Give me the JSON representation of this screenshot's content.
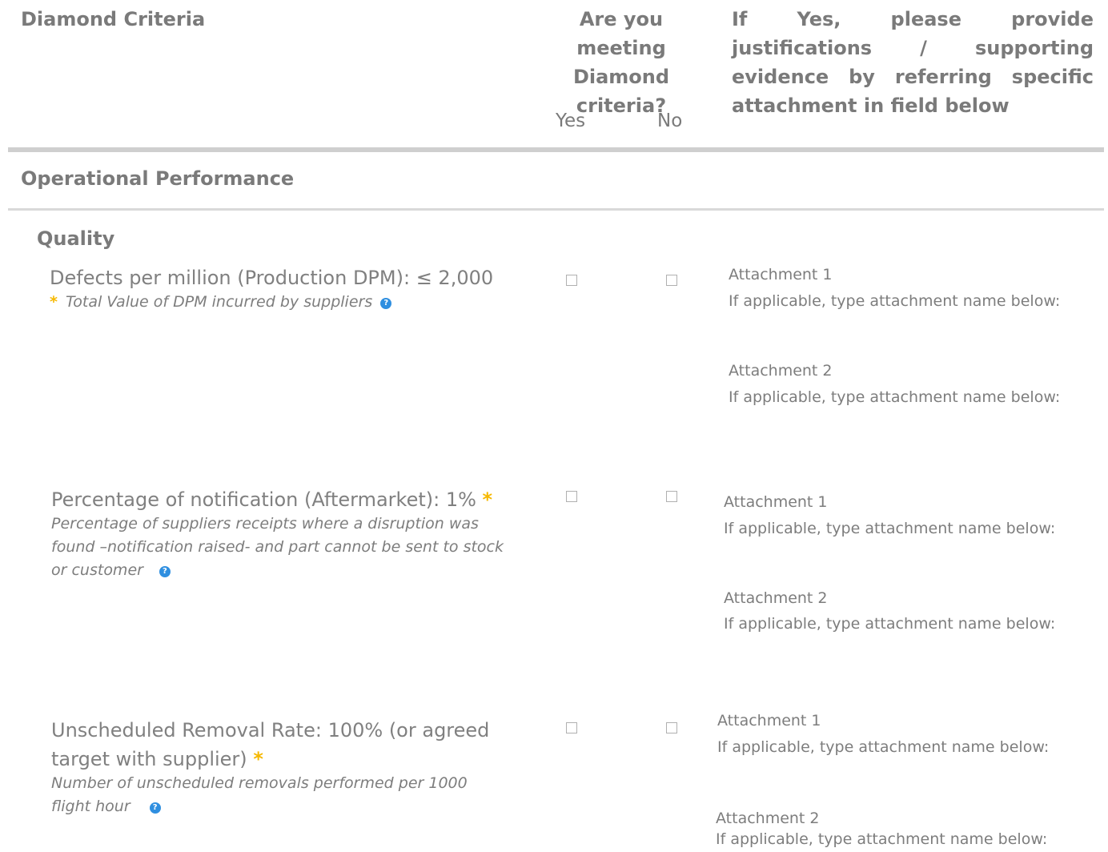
{
  "header": {
    "criteria": "Diamond Criteria",
    "meeting": "Are you meeting Diamond criteria?",
    "justification": "If Yes, please provide justifications / supporting evidence by referring specific attachment in field below",
    "yes": "Yes",
    "no": "No"
  },
  "section": {
    "title": "Operational Performance"
  },
  "subsection": {
    "title": "Quality"
  },
  "required_mark": "*",
  "help_glyph": "?",
  "attachment": {
    "label1": "Attachment 1",
    "label2": "Attachment 2",
    "hint": "If applicable, type attachment name below:"
  },
  "criteria": [
    {
      "title": "Defects per million (Production DPM): ≤ 2,000",
      "description": "Total Value of DPM incurred by suppliers"
    },
    {
      "title": "Percentage of notification (Aftermarket): 1%",
      "description": "Percentage of suppliers receipts where a disruption was found –notification raised- and part cannot be sent to stock or customer"
    },
    {
      "title": "Unscheduled Removal Rate: 100% (or agreed target with supplier)",
      "description": "Number of unscheduled removals performed per 1000 flight hour"
    }
  ],
  "colors": {
    "required": "#f6b800",
    "help": "#2f8fe0",
    "text": "#777777",
    "rule": "#cfcfcf"
  }
}
